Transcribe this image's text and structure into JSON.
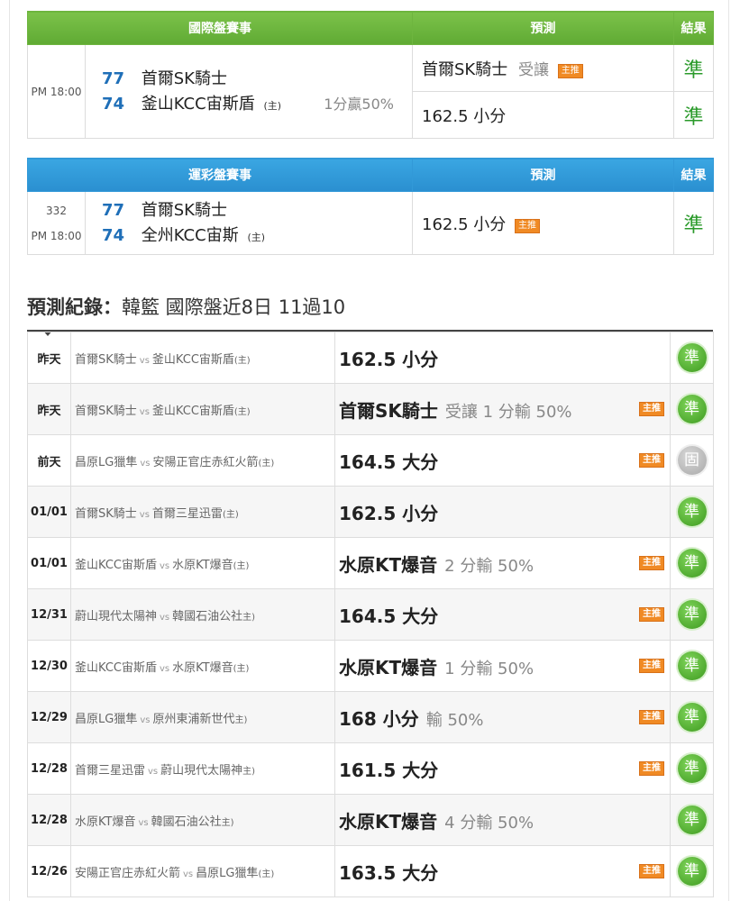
{
  "intl_table": {
    "header": {
      "match": "國際盤賽事",
      "prediction": "預測",
      "result": "結果"
    },
    "time": "PM 18:00",
    "team1": {
      "score": "77",
      "name": "首爾SK騎士"
    },
    "team2": {
      "score": "74",
      "name": "釜山KCC宙斯盾",
      "home": "(主)"
    },
    "handicap": "1分贏50%",
    "predictions": [
      {
        "main": "首爾SK騎士",
        "sub": "受讓",
        "tag": "主推",
        "result": "準"
      },
      {
        "main": "162.5 小分",
        "sub": "",
        "tag": "",
        "result": "準"
      }
    ]
  },
  "lottery_table": {
    "header": {
      "match": "運彩盤賽事",
      "prediction": "預測",
      "result": "結果"
    },
    "game_no": "332",
    "time": "PM 18:00",
    "team1": {
      "score": "77",
      "name": "首爾SK騎士"
    },
    "team2": {
      "score": "74",
      "name": "全州KCC宙斯",
      "home": "(主)"
    },
    "prediction": {
      "main": "162.5 小分",
      "tag": "主推",
      "result": "準"
    }
  },
  "records": {
    "title_bold": "預測紀錄：",
    "title_rest": "韓籃 國際盤近8日 11過10",
    "rows": [
      {
        "date": "昨天",
        "home": "首爾SK騎士",
        "vs": "vs",
        "away": "釜山KCC宙斯盾",
        "mark": "(主)",
        "pick": "162.5 小分",
        "note": "",
        "tag": "",
        "result": "準"
      },
      {
        "date": "昨天",
        "home": "首爾SK騎士",
        "vs": "vs",
        "away": "釜山KCC宙斯盾",
        "mark": "(主)",
        "pick": "首爾SK騎士",
        "note": "受讓 1 分輸 50%",
        "tag": "主推",
        "result": "準"
      },
      {
        "date": "前天",
        "home": "昌原LG獵隼",
        "vs": "vs",
        "away": "安陽正官庄赤紅火箭",
        "mark": "(主)",
        "pick": "164.5 大分",
        "note": "",
        "tag": "主推",
        "result": "固"
      },
      {
        "date": "01/01",
        "home": "首爾SK騎士",
        "vs": "vs",
        "away": "首爾三星迅雷",
        "mark": "(主)",
        "pick": "162.5 小分",
        "note": "",
        "tag": "",
        "result": "準"
      },
      {
        "date": "01/01",
        "home": "釜山KCC宙斯盾",
        "vs": "vs",
        "away": "水原KT爆音",
        "mark": "(主)",
        "pick": "水原KT爆音",
        "note": "2 分輸 50%",
        "tag": "主推",
        "result": "準"
      },
      {
        "date": "12/31",
        "home": "蔚山現代太陽神",
        "vs": "vs",
        "away": "韓國石油公社",
        "mark": "主)",
        "pick": "164.5 大分",
        "note": "",
        "tag": "主推",
        "result": "準"
      },
      {
        "date": "12/30",
        "home": "釜山KCC宙斯盾",
        "vs": "vs",
        "away": "水原KT爆音",
        "mark": "(主)",
        "pick": "水原KT爆音",
        "note": "1 分輸 50%",
        "tag": "主推",
        "result": "準"
      },
      {
        "date": "12/29",
        "home": "昌原LG獵隼",
        "vs": "vs",
        "away": "原州東浦新世代",
        "mark": "主)",
        "pick": "168 小分",
        "note": "輸 50%",
        "tag": "主推",
        "result": "準"
      },
      {
        "date": "12/28",
        "home": "首爾三星迅雷",
        "vs": "vs",
        "away": "蔚山現代太陽神",
        "mark": "主)",
        "pick": "161.5 大分",
        "note": "",
        "tag": "主推",
        "result": "準"
      },
      {
        "date": "12/28",
        "home": "水原KT爆音",
        "vs": "vs",
        "away": "韓國石油公社",
        "mark": "主)",
        "pick": "水原KT爆音",
        "note": "4 分輸 50%",
        "tag": "",
        "result": "準"
      },
      {
        "date": "12/26",
        "home": "安陽正官庄赤紅火箭",
        "vs": "vs",
        "away": "昌原LG獵隼",
        "mark": "(主)",
        "pick": "163.5 大分",
        "note": "",
        "tag": "主推",
        "result": "準"
      }
    ]
  },
  "colors": {
    "green_header": "#5faa33",
    "blue_header": "#2a8fd0",
    "win": "#2a9a2a",
    "score": "#1f6fb8",
    "tag": "#f08a24"
  }
}
